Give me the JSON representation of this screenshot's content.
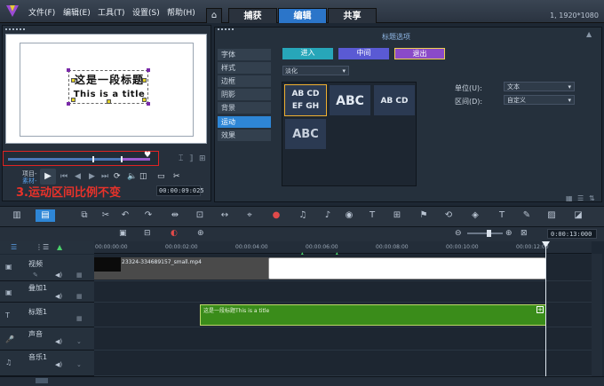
{
  "titlebar": {
    "menus": [
      "文件(F)",
      "编辑(E)",
      "工具(T)",
      "设置(S)",
      "帮助(H)"
    ],
    "tabs": [
      "捕获",
      "编辑",
      "共享"
    ],
    "active_tab": "编辑",
    "resolution": "1, 1920*1080"
  },
  "preview": {
    "title_line1": "这是一段标题",
    "title_line2": "This is a title",
    "project_label": "项目-",
    "clip_label": "素材-",
    "timecode": "00:00:09:025",
    "annotation": "3.运动区间比例不变"
  },
  "options": {
    "header": "标题选项",
    "sidebar": [
      "字体",
      "样式",
      "边框",
      "阴影",
      "背景",
      "运动",
      "效果"
    ],
    "active_sidebar": "运动",
    "tabs": [
      "进入",
      "中间",
      "退出"
    ],
    "active_tab": "退出",
    "effect_dropdown": "淡化",
    "tiles": [
      "AB CD EF GH",
      "ABC",
      "AB CD",
      "ABC"
    ],
    "unit_label": "单位(U):",
    "unit_value": "文本",
    "range_label": "区间(D):",
    "range_value": "自定义"
  },
  "timeline": {
    "timecode": "0:00:13:000",
    "ruler_ticks": [
      "00:00:00:00",
      "00:00:02:00",
      "00:00:04:00",
      "00:00:06:00",
      "00:00:08:00",
      "00:00:10:00",
      "00:00:12:00"
    ],
    "tracks": [
      "视频",
      "叠加1",
      "标题1",
      "声音",
      "音乐1"
    ],
    "video_clip": "23324-334689157_small.mp4",
    "title_clip": "这是一段标题This is a title"
  }
}
